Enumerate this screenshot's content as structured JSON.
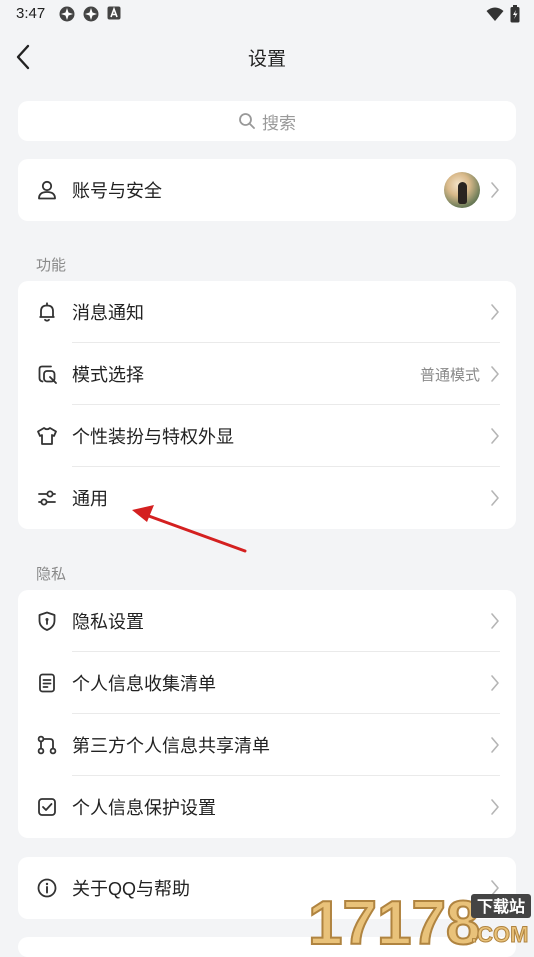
{
  "status_bar": {
    "time": "3:47"
  },
  "header": {
    "title": "设置"
  },
  "search": {
    "placeholder": "搜索"
  },
  "account": {
    "label": "账号与安全"
  },
  "sections": {
    "function": {
      "title": "功能",
      "items": [
        {
          "label": "消息通知",
          "icon": "bell-icon"
        },
        {
          "label": "模式选择",
          "value": "普通模式",
          "icon": "mode-icon"
        },
        {
          "label": "个性装扮与特权外显",
          "icon": "tshirt-icon"
        },
        {
          "label": "通用",
          "icon": "sliders-icon"
        }
      ]
    },
    "privacy": {
      "title": "隐私",
      "items": [
        {
          "label": "隐私设置",
          "icon": "shield-icon"
        },
        {
          "label": "个人信息收集清单",
          "icon": "document-icon"
        },
        {
          "label": "第三方个人信息共享清单",
          "icon": "share-icon"
        },
        {
          "label": "个人信息保护设置",
          "icon": "checkbox-icon"
        }
      ]
    }
  },
  "about": {
    "label": "关于QQ与帮助",
    "icon": "info-icon"
  },
  "watermark": {
    "number": "17178",
    "tag": "下载站",
    "domain": ".COM"
  },
  "colors": {
    "background": "#f3f4f6",
    "card": "#ffffff",
    "arrow": "#d42020",
    "text": "#222222",
    "secondary": "#8a8a8a"
  }
}
